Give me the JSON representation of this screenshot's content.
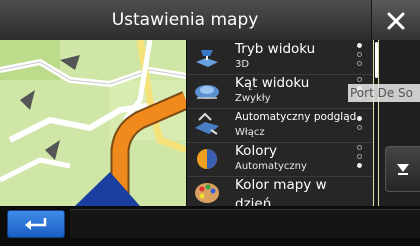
{
  "window": {
    "title": "Ustawienia mapy"
  },
  "settings": [
    {
      "label": "Tryb widoku",
      "value": "3D",
      "icon": "map-view-mode-icon",
      "option_count": 3,
      "selected_index": 0
    },
    {
      "label": "Kąt widoku",
      "value": "Zwykły",
      "icon": "viewing-angle-icon",
      "option_count": 3,
      "selected_index": 1
    },
    {
      "label": "Automatyczny podgląd",
      "value": "Włącz",
      "icon": "auto-overview-icon",
      "option_count": 2,
      "selected_index": 0
    },
    {
      "label": "Kolory",
      "value": "Automatyczny",
      "icon": "day-night-colors-icon",
      "option_count": 3,
      "selected_index": 2
    },
    {
      "label": "Kolor mapy w",
      "value": "dzień",
      "icon": "day-map-color-palette-icon"
    }
  ],
  "map": {
    "place_label": "Port De So"
  },
  "buttons": {
    "close_icon": "close-icon",
    "scroll_down_icon": "scroll-down-icon",
    "back_icon": "back-arrow-icon"
  },
  "colors": {
    "back_button": "#2a72d8",
    "route": "#f08a1c",
    "list_background": "#262626"
  }
}
